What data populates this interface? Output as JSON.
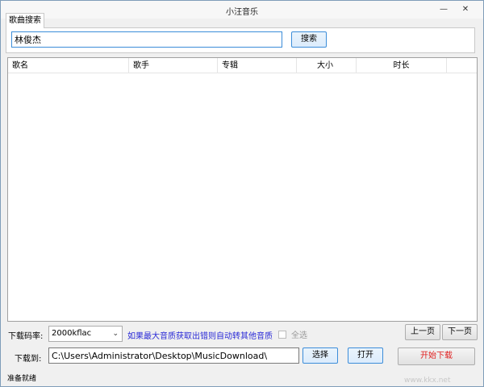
{
  "window": {
    "title": "小汪音乐",
    "minimize_glyph": "—",
    "close_glyph": "✕"
  },
  "search": {
    "tab_label": "歌曲搜索",
    "query": "林俊杰",
    "button_label": "搜索"
  },
  "table": {
    "columns": [
      "歌名",
      "歌手",
      "专辑",
      "大小",
      "时长"
    ],
    "rows": []
  },
  "controls": {
    "bitrate_label": "下载码率:",
    "bitrate_value": "2000kflac",
    "hint": "如果最大音质获取出错则自动转其他音质",
    "select_all": "全选",
    "prev_page": "上一页",
    "next_page": "下一页",
    "download_to_label": "下载到:",
    "download_path": "C:\\Users\\Administrator\\Desktop\\MusicDownload\\",
    "choose_button": "选择",
    "open_button": "打开",
    "start_download": "开始下载"
  },
  "status": {
    "text": "准备就绪"
  },
  "watermark": "www.kkx.net"
}
